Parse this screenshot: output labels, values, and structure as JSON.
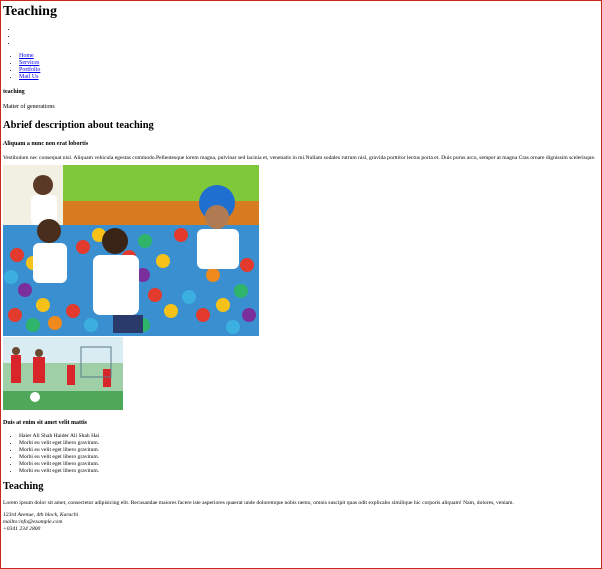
{
  "header": {
    "title": "Teaching"
  },
  "dots": [
    "",
    "",
    ""
  ],
  "nav": {
    "items": [
      {
        "label": "Home"
      },
      {
        "label": "Services"
      },
      {
        "label": "Portfolio"
      },
      {
        "label": "Mail Us"
      }
    ]
  },
  "intro": {
    "label": "teaching",
    "tagline": "Matter of generations"
  },
  "about": {
    "heading": "Abrief description about teaching",
    "subheading": "Aliquam a nunc non erat lobortis",
    "paragraph": "Vestibulum nec consequat nisl. Aliquam vehicula egestas commodo.Pellentesque lorem magna, pulvinar sed lacinia et, venenatis in mi.Nullam sodales rutrum nisl, gravida porttitor lectus porta et. Duis purus arcu, semper at magna Cras ornare dignissim scelerisque."
  },
  "list_section": {
    "heading": "Duis at enim sit amet velit mattis",
    "items": [
      "Haier Ali Shah Haider Ali Shah Hai",
      "Morbi eu velit eget libero gravitum.",
      "Morbi eu velit eget libero gravitum.",
      "Morbi eu velit eget libero gravitum.",
      "Morbi eu velit eget libero gravitum.",
      "Morbi eu velit eget libero gravitum."
    ]
  },
  "footer": {
    "heading": "Teaching",
    "paragraph": "Lorem ipsum dolor sit amet, consectetur adipisicing elit. Recusandae maiores facere iste asperiores quaerat unde doloremque nobis nemo, omnis suscipit quas odit explicabo similique hic corporis aliquam! Nam, dolores, veniam.",
    "address_line": "123rd Avenue, 4th block, Karachi",
    "email": "mailto:info@example.com",
    "phone": "+0341 234 2800"
  }
}
